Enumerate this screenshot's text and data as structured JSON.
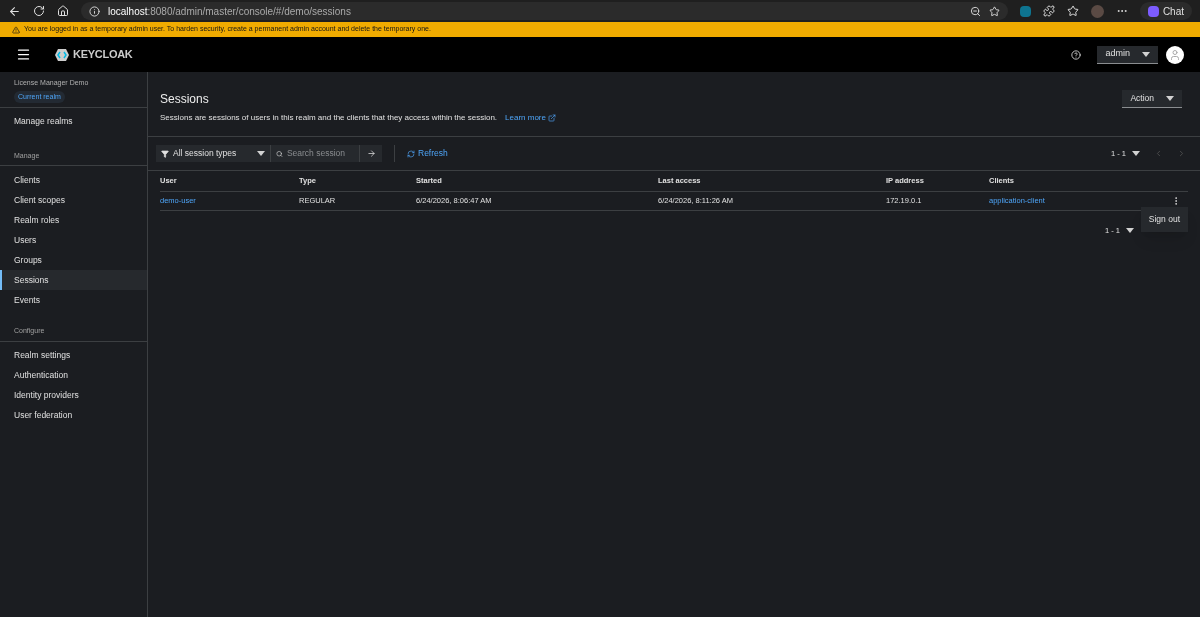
{
  "browser": {
    "url_host": "localhost",
    "url_path": ":8080/admin/master/console/#/demo/sessions",
    "chat_label": "Chat"
  },
  "warning": {
    "text": "You are logged in as a temporary admin user. To harden security, create a permanent admin account and delete the temporary one."
  },
  "header": {
    "logo": "KEYCLOAK",
    "user_menu": "admin"
  },
  "sidebar": {
    "realm_name": "License Manager Demo",
    "realm_badge": "Current realm",
    "top_item": "Manage realms",
    "sections": [
      {
        "heading": "Manage",
        "items": [
          {
            "label": "Clients",
            "selected": false
          },
          {
            "label": "Client scopes",
            "selected": false
          },
          {
            "label": "Realm roles",
            "selected": false
          },
          {
            "label": "Users",
            "selected": false
          },
          {
            "label": "Groups",
            "selected": false
          },
          {
            "label": "Sessions",
            "selected": true
          },
          {
            "label": "Events",
            "selected": false
          }
        ]
      },
      {
        "heading": "Configure",
        "items": [
          {
            "label": "Realm settings",
            "selected": false
          },
          {
            "label": "Authentication",
            "selected": false
          },
          {
            "label": "Identity providers",
            "selected": false
          },
          {
            "label": "User federation",
            "selected": false
          }
        ]
      }
    ]
  },
  "page": {
    "title": "Sessions",
    "description": "Sessions are sessions of users in this realm and the clients that they access within the session.",
    "learn_more": "Learn more",
    "action_button": "Action"
  },
  "toolbar": {
    "filter": "All session types",
    "search_placeholder": "Search session",
    "refresh": "Refresh",
    "pagination": "1 - 1"
  },
  "table": {
    "columns": [
      "User",
      "Type",
      "Started",
      "Last access",
      "IP address",
      "Clients"
    ],
    "rows": [
      {
        "user": "demo-user",
        "type": "REGULAR",
        "started": "6/24/2026, 8:06:47 AM",
        "last_access": "6/24/2026, 8:11:26 AM",
        "ip": "172.19.0.1",
        "client": "application-client"
      }
    ]
  },
  "bottom_pagination": "1 - 1",
  "row_menu": {
    "items": [
      "Sign out"
    ]
  }
}
